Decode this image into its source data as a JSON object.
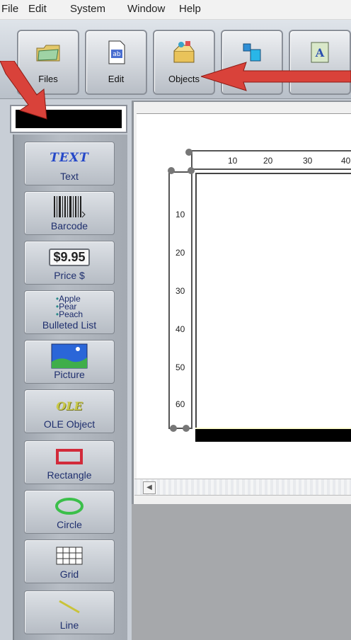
{
  "menu": [
    "File",
    "Edit",
    "System",
    "Window",
    "Help"
  ],
  "toolbar": {
    "buttons": [
      {
        "label": "Files",
        "icon": "folder-icon"
      },
      {
        "label": "Edit",
        "icon": "edit-document-icon"
      },
      {
        "label": "Objects",
        "icon": "objects-box-icon"
      },
      {
        "label": "",
        "icon": "layout-icon"
      },
      {
        "label": "",
        "icon": "text-format-icon"
      }
    ]
  },
  "palette": {
    "items": [
      {
        "label": "Text",
        "icon_text": "TEXT"
      },
      {
        "label": "Barcode"
      },
      {
        "label": "Price $",
        "icon_text": "$9.95"
      },
      {
        "label": "Bulleted List",
        "bullets": [
          "Apple",
          "Pear",
          "Peach"
        ]
      },
      {
        "label": "Picture"
      },
      {
        "label": "OLE Object",
        "icon_text": "OLE"
      },
      {
        "label": "Rectangle"
      },
      {
        "label": "Circle"
      },
      {
        "label": "Grid"
      },
      {
        "label": "Line"
      }
    ]
  },
  "ruler": {
    "horizontal": [
      "10",
      "20",
      "30",
      "40"
    ],
    "vertical": [
      "10",
      "20",
      "30",
      "40",
      "50",
      "60"
    ]
  },
  "colors": {
    "arrow": "#d9423a",
    "field_fill": "#000000"
  }
}
